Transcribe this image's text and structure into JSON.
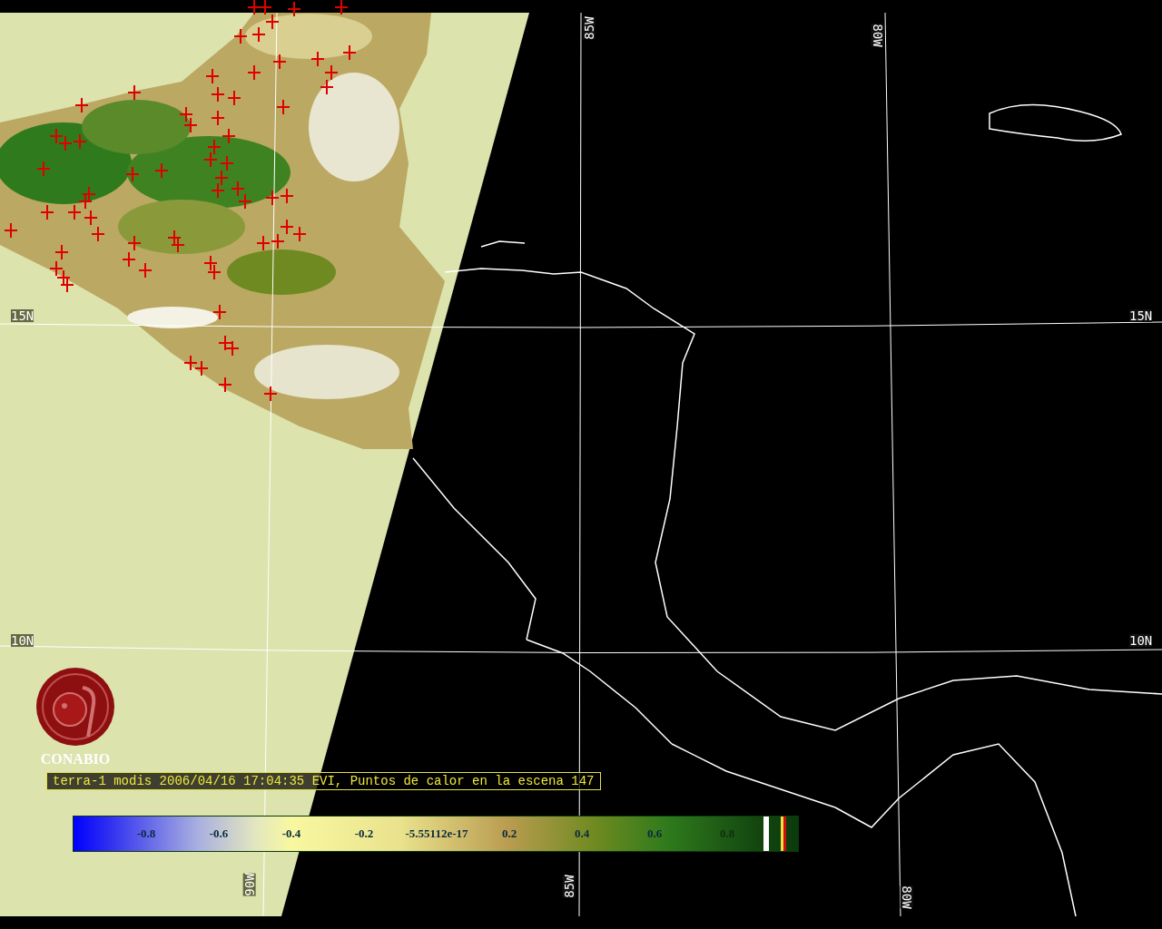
{
  "grid_labels": {
    "top": [
      "85W",
      "80W"
    ],
    "left": [
      "15N",
      "10N"
    ],
    "right": [
      "15N",
      "10N"
    ],
    "bottom": [
      "90W",
      "85W",
      "80W"
    ]
  },
  "logo": {
    "name": "CONABIO"
  },
  "caption": "terra-1 modis 2006/04/16 17:04:35 EVI, Puntos de calor en la escena 147",
  "colorbar": {
    "tick_labels": [
      "-0.8",
      "-0.6",
      "-0.4",
      "-0.2",
      "-5.55112e-17",
      "0.2",
      "0.4",
      "0.6",
      "0.8"
    ]
  }
}
